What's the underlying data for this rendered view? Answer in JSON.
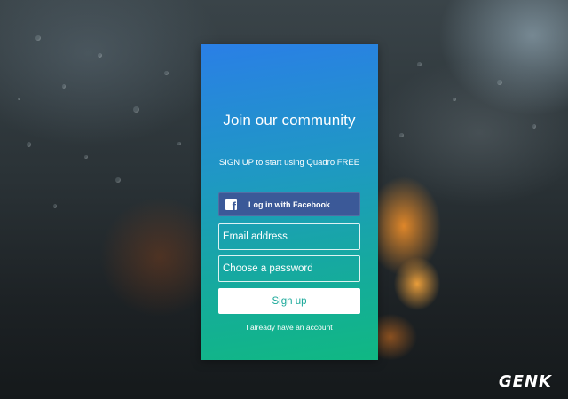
{
  "card": {
    "title": "Join our community",
    "subtitle": "SIGN UP to start using Quadro FREE",
    "facebook_button": {
      "label": "Log in with Facebook",
      "icon": "facebook-icon",
      "color": "#3b5998"
    },
    "email_field": {
      "placeholder": "Email address",
      "value": ""
    },
    "password_field": {
      "placeholder": "Choose a password",
      "value": ""
    },
    "signup_button": {
      "label": "Sign up",
      "text_color": "#1ba99a"
    },
    "login_link": "I already have an account",
    "gradient": {
      "top": "#2a7fe6",
      "bottom": "#10b883"
    }
  },
  "watermark": "GENK"
}
